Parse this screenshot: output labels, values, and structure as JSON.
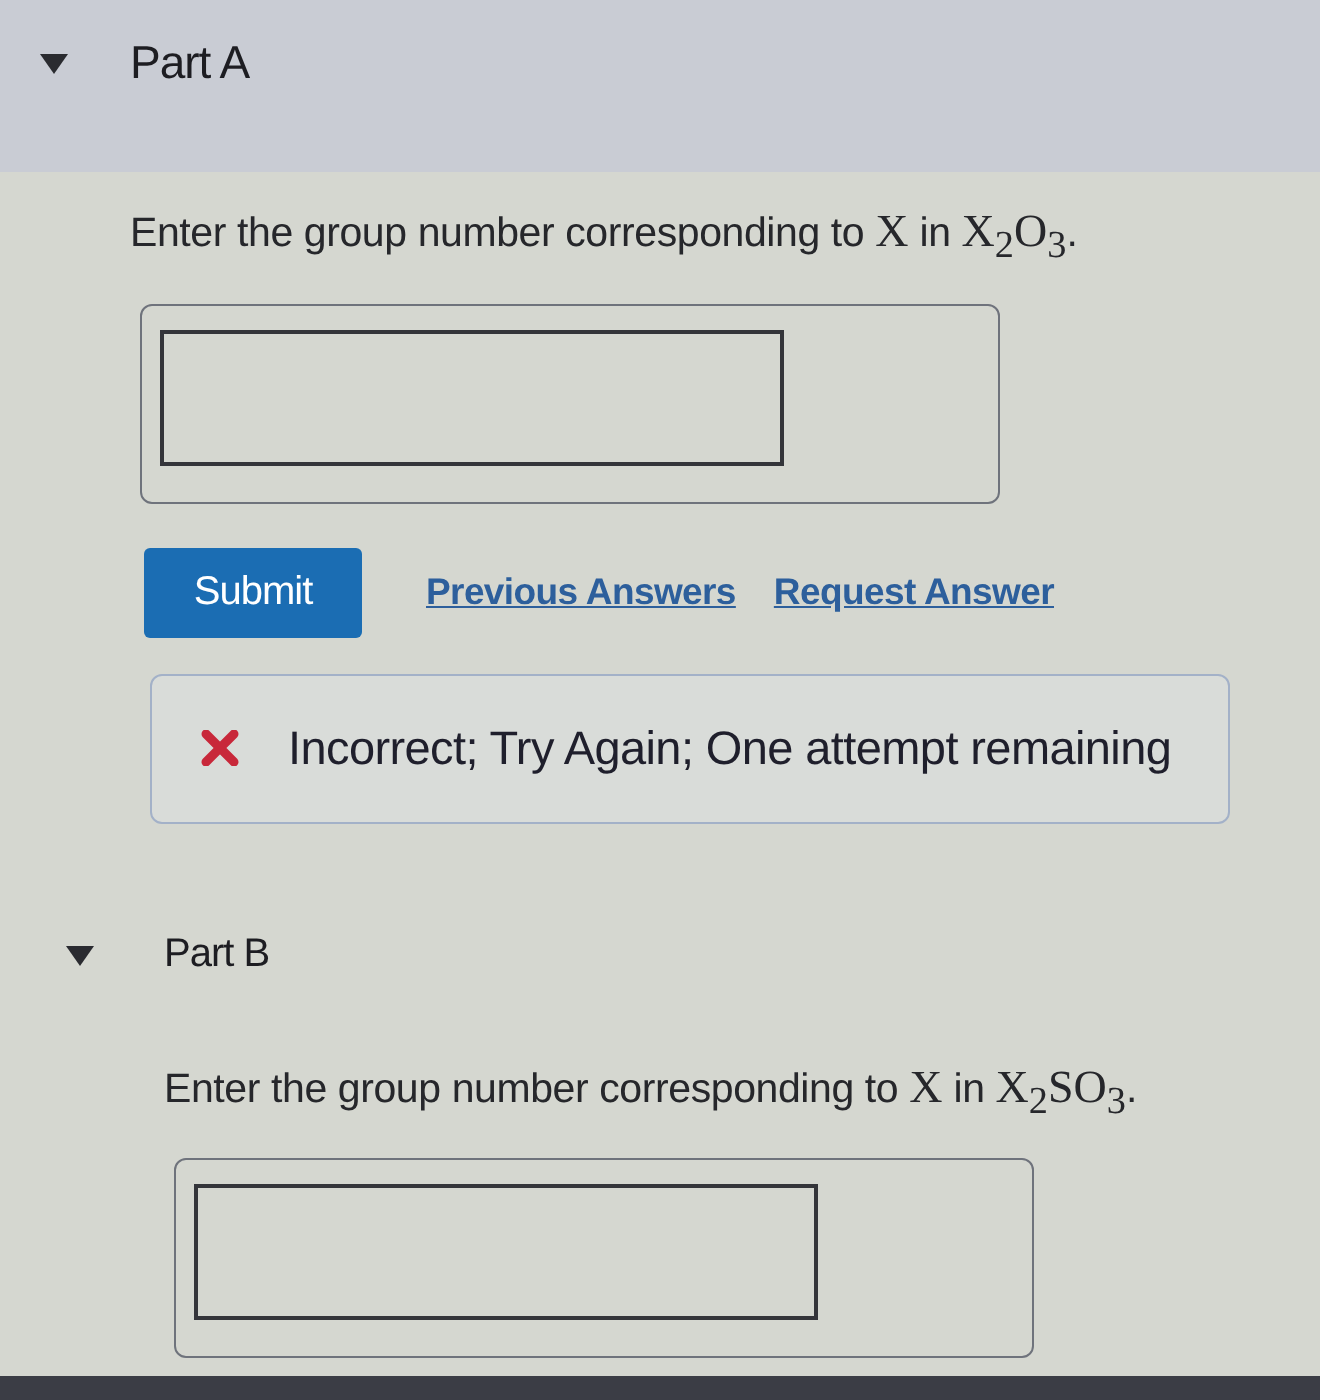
{
  "parts": [
    {
      "title": "Part A",
      "expanded": true,
      "selected": true,
      "prompt": [
        {
          "kind": "text",
          "text": "Enter the group number corresponding to "
        },
        {
          "kind": "math",
          "text": "X"
        },
        {
          "kind": "text",
          "text": " in "
        },
        {
          "kind": "math",
          "text": "X$_{2}$O$_{3}$"
        },
        {
          "kind": "text",
          "text": "."
        }
      ],
      "submit": {
        "label": "Submit"
      },
      "links": [
        "Previous Answers",
        "Request Answer"
      ],
      "feedback": {
        "kind": "incorrect",
        "text": "Incorrect; Try Again; One attempt remaining"
      }
    },
    {
      "title": "Part B",
      "expanded": true,
      "selected": false,
      "prompt": [
        {
          "kind": "text",
          "text": "Enter the group number corresponding to "
        },
        {
          "kind": "math",
          "text": "X"
        },
        {
          "kind": "text",
          "text": " in "
        },
        {
          "kind": "math",
          "text": "X$_{2}$SO$_{3}$"
        },
        {
          "kind": "text",
          "text": "."
        }
      ]
    }
  ]
}
